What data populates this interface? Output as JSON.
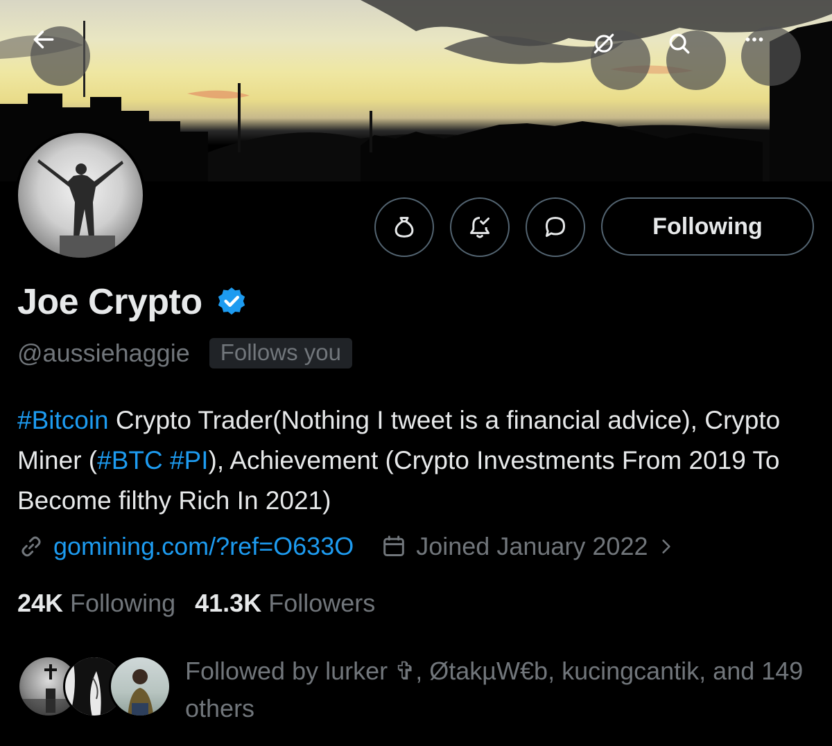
{
  "banner": {
    "back_icon": "arrow-left-icon",
    "grok_icon": "grok-icon",
    "search_icon": "search-icon",
    "more_icon": "more-horizontal-icon"
  },
  "actions": {
    "tip_icon": "money-bag-icon",
    "notify_icon": "bell-check-icon",
    "message_icon": "chat-bubble-icon",
    "follow_label": "Following"
  },
  "profile": {
    "display_name": "Joe Crypto",
    "verified": true,
    "handle": "@aussiehaggie",
    "follows_you_label": "Follows you",
    "bio": {
      "tag1": "#Bitcoin",
      "text1": " Crypto Trader(Nothing I tweet is a financial advice), Crypto Miner (",
      "tag2": "#BTC",
      "text2": " ",
      "tag3": "#PI",
      "text3": "), Achievement (Crypto Investments From 2019 To Become filthy Rich In 2021)"
    },
    "link": "gomining.com/?ref=O633O",
    "joined": "Joined January 2022"
  },
  "stats": {
    "following_count": "24K",
    "following_label": "Following",
    "followers_count": "41.3K",
    "followers_label": "Followers"
  },
  "followed_by": {
    "text": "Followed by lurker ✞, ØtakµW€b, kucingcantik, and 149 others"
  },
  "colors": {
    "accent": "#1d9bf0",
    "muted": "#71767b",
    "text": "#e7e9ea",
    "background": "#000000"
  }
}
